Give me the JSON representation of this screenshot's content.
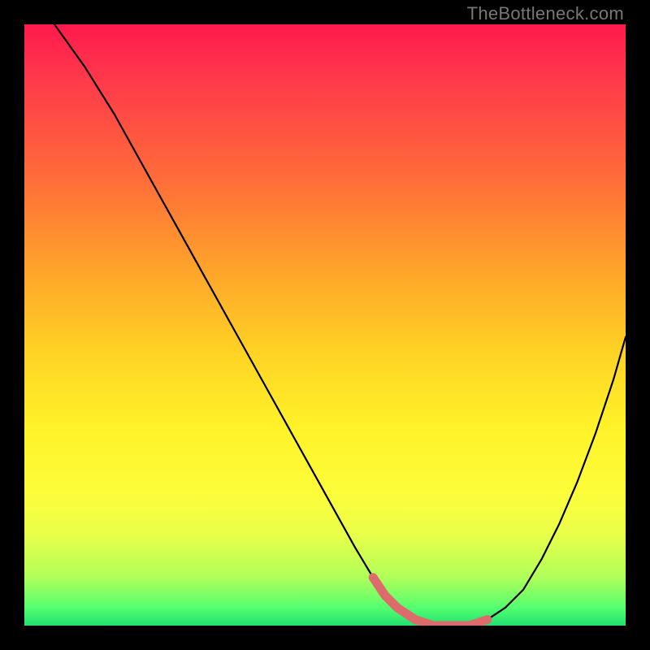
{
  "watermark": "TheBottleneck.com",
  "chart_data": {
    "type": "line",
    "title": "",
    "xlabel": "",
    "ylabel": "",
    "xlim": [
      0,
      100
    ],
    "ylim": [
      0,
      100
    ],
    "series": [
      {
        "name": "bottleneck-curve",
        "color": "#000000",
        "x": [
          5,
          10,
          15,
          20,
          25,
          30,
          35,
          40,
          45,
          50,
          55,
          58,
          60,
          62,
          65,
          68,
          71,
          74,
          77,
          80,
          83,
          86,
          89,
          92,
          95,
          98,
          100
        ],
        "y": [
          100,
          93,
          85,
          76,
          67,
          58,
          49,
          40,
          31,
          22,
          13,
          8,
          5,
          3,
          1,
          0,
          0,
          0,
          1,
          3,
          6,
          11,
          17,
          24,
          32,
          41,
          48
        ]
      },
      {
        "name": "optimal-range",
        "color": "#e06666",
        "x": [
          58,
          60,
          62,
          65,
          68,
          71,
          74,
          77
        ],
        "y": [
          8,
          5,
          3,
          1,
          0,
          0,
          0,
          1
        ]
      }
    ]
  }
}
